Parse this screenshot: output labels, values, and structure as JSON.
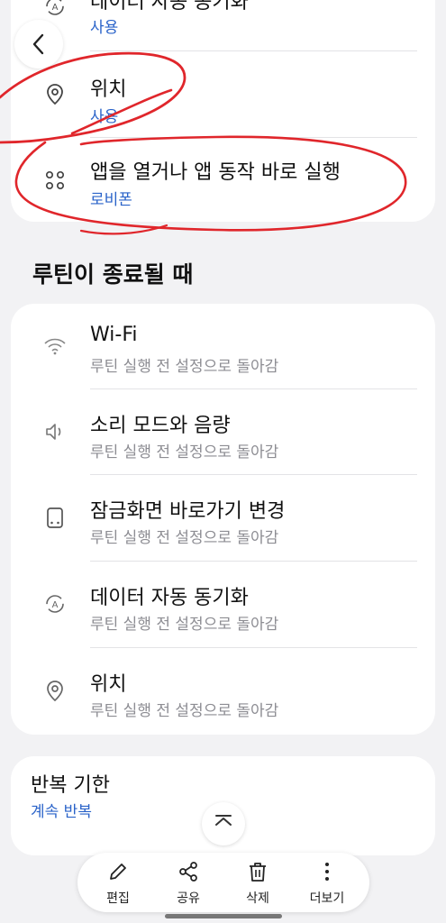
{
  "top_card": {
    "partial_item": {
      "title": "데이터 자동 동기화",
      "subtitle": "사용"
    },
    "items": [
      {
        "title": "위치",
        "subtitle": "사용",
        "icon": "location-pin-icon"
      },
      {
        "title": "앱을 열거나 앱 동작 바로 실행",
        "subtitle": "로비폰",
        "icon": "apps-grid-icon"
      }
    ]
  },
  "section_title": "루틴이 종료될 때",
  "end_card": {
    "items": [
      {
        "title": "Wi-Fi",
        "subtitle": "루틴 실행 전 설정으로 돌아감",
        "icon": "wifi-icon"
      },
      {
        "title": "소리 모드와 음량",
        "subtitle": "루틴 실행 전 설정으로 돌아감",
        "icon": "speaker-icon"
      },
      {
        "title": "잠금화면 바로가기 변경",
        "subtitle": "루틴 실행 전 설정으로 돌아감",
        "icon": "lockscreen-icon"
      },
      {
        "title": "데이터 자동 동기화",
        "subtitle": "루틴 실행 전 설정으로 돌아감",
        "icon": "sync-icon"
      },
      {
        "title": "위치",
        "subtitle": "루틴 실행 전 설정으로 돌아감",
        "icon": "location-pin-icon"
      }
    ]
  },
  "repeat_card": {
    "title": "반복 기한",
    "value": "계속 반복"
  },
  "bottom_bar": {
    "edit": "편집",
    "share": "공유",
    "delete": "삭제",
    "more": "더보기"
  },
  "colors": {
    "accent_blue": "#2a63c9",
    "annotation_red": "#e0262b",
    "background": "#f2f2f4"
  }
}
